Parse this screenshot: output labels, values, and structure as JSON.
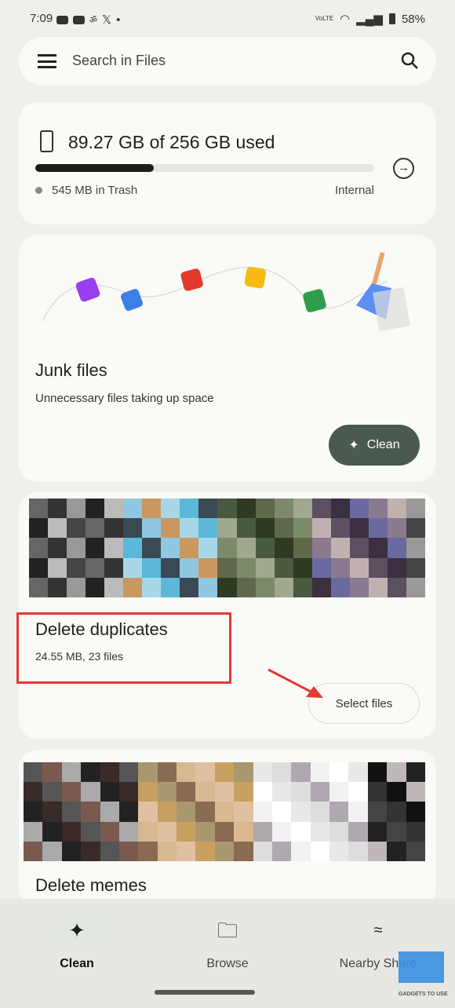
{
  "status_bar": {
    "time": "7:09",
    "battery": "58%",
    "network": "VoLTE"
  },
  "search": {
    "placeholder": "Search in Files"
  },
  "storage": {
    "title": "89.27 GB of 256 GB used",
    "used_gb": 89.27,
    "total_gb": 256,
    "trash": "545 MB in Trash",
    "location": "Internal"
  },
  "junk": {
    "title": "Junk files",
    "subtitle": "Unnecessary files taking up space",
    "button": "Clean"
  },
  "duplicates": {
    "title": "Delete duplicates",
    "subtitle": "24.55 MB, 23 files",
    "button": "Select files"
  },
  "memes": {
    "title": "Delete memes"
  },
  "nav": {
    "items": [
      {
        "label": "Clean",
        "icon": "sparkle-icon",
        "active": true
      },
      {
        "label": "Browse",
        "icon": "folder-search-icon"
      },
      {
        "label": "Nearby Share",
        "icon": "nearby-share-icon"
      }
    ]
  },
  "watermark": {
    "text": "GADGETS TO USE"
  },
  "colors": {
    "accent": "#4a5a4e",
    "highlight": "#e53935"
  }
}
